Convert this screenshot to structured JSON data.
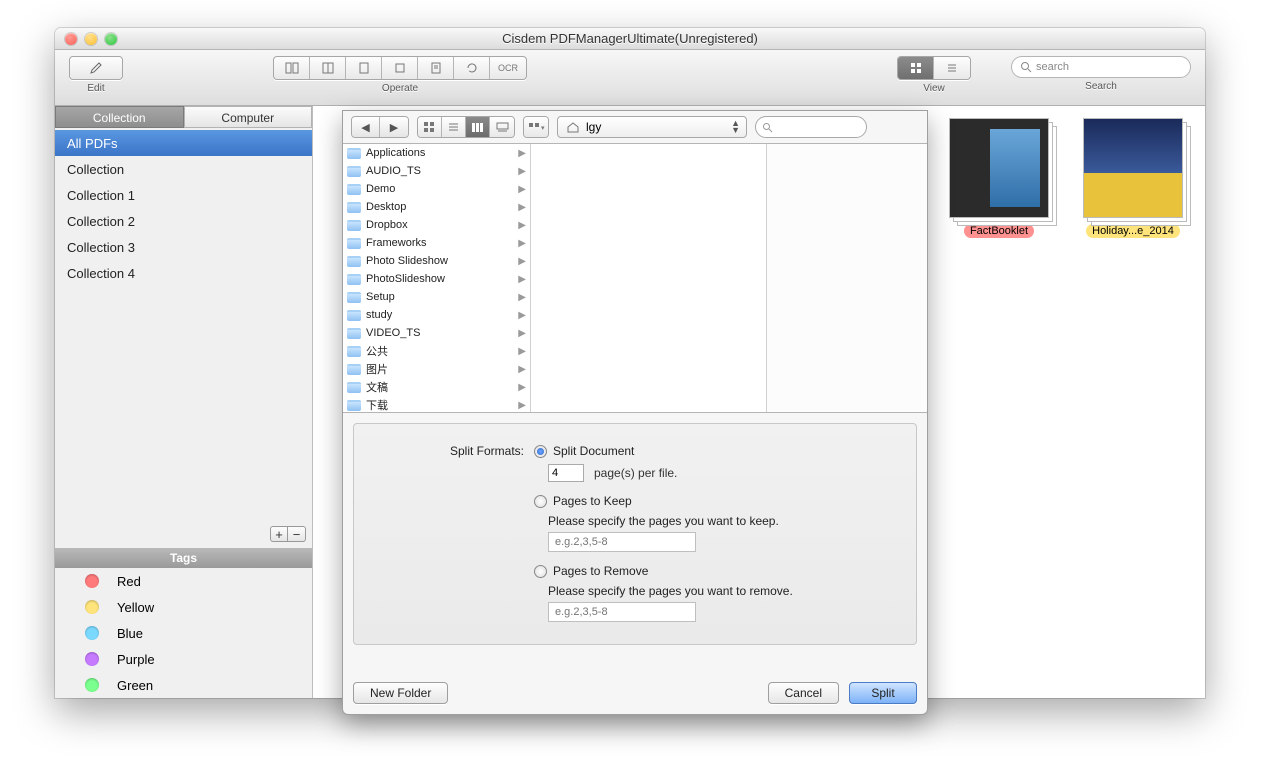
{
  "window": {
    "title": "Cisdem PDFManagerUltimate(Unregistered)"
  },
  "toolbar": {
    "edit_label": "Edit",
    "operate_label": "Operate",
    "view_label": "View",
    "search_label": "Search",
    "search_placeholder": "search"
  },
  "sidebar": {
    "tabs": {
      "collection": "Collection",
      "computer": "Computer"
    },
    "items": [
      {
        "label": "All PDFs",
        "selected": true
      },
      {
        "label": "Collection"
      },
      {
        "label": "Collection 1"
      },
      {
        "label": "Collection 2"
      },
      {
        "label": "Collection 3"
      },
      {
        "label": "Collection 4"
      }
    ],
    "tags_header": "Tags",
    "tags": [
      {
        "label": "Red",
        "color": "#ff7b7b"
      },
      {
        "label": "Yellow",
        "color": "#ffe47b"
      },
      {
        "label": "Blue",
        "color": "#7bd9ff"
      },
      {
        "label": "Purple",
        "color": "#c67bff"
      },
      {
        "label": "Green",
        "color": "#7bff8e"
      }
    ]
  },
  "thumbs": [
    {
      "caption": "FactBooklet",
      "caption_class": "cap1"
    },
    {
      "caption": "Holiday...e_2014",
      "caption_class": "cap2"
    }
  ],
  "dialog": {
    "path_label": "lgy",
    "folders": [
      "Applications",
      "AUDIO_TS",
      "Demo",
      "Desktop",
      "Dropbox",
      "Frameworks",
      "Photo Slideshow",
      "PhotoSlideshow",
      "Setup",
      "study",
      "VIDEO_TS",
      "公共",
      "图片",
      "文稿",
      "下载"
    ],
    "split_formats_label": "Split Formats:",
    "opt_split_doc": "Split Document",
    "pages_value": "4",
    "pages_suffix": "page(s) per file.",
    "opt_keep": "Pages to Keep",
    "keep_hint": "Please specify the pages you want to keep.",
    "keep_placeholder": "e.g.2,3,5-8",
    "opt_remove": "Pages to Remove",
    "remove_hint": "Please specify the pages you want to remove.",
    "remove_placeholder": "e.g.2,3,5-8",
    "new_folder": "New Folder",
    "cancel": "Cancel",
    "split": "Split"
  }
}
